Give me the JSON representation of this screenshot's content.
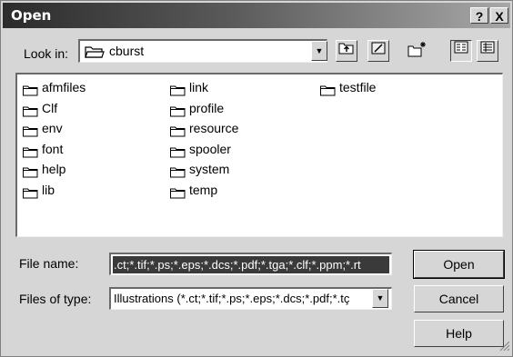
{
  "window": {
    "title": "Open",
    "help_glyph": "?",
    "close_glyph": "X"
  },
  "lookin": {
    "label": "Look in:",
    "value": "cburst"
  },
  "toolbar": {
    "icons": [
      "up-one-level-icon",
      "desktop-icon",
      "create-new-folder-icon",
      "list-view-icon",
      "details-view-icon"
    ]
  },
  "files": {
    "items": [
      {
        "name": "afmfiles"
      },
      {
        "name": "Clf"
      },
      {
        "name": "env"
      },
      {
        "name": "font"
      },
      {
        "name": "help"
      },
      {
        "name": "lib"
      },
      {
        "name": "link"
      },
      {
        "name": "profile"
      },
      {
        "name": "resource"
      },
      {
        "name": "spooler"
      },
      {
        "name": "system"
      },
      {
        "name": "temp"
      },
      {
        "name": "testfile"
      }
    ]
  },
  "filename": {
    "label": "File name:",
    "value": ".ct;*.tif;*.ps;*.eps;*.dcs;*.pdf;*.tga;*.clf;*.ppm;*.rt"
  },
  "filetype": {
    "label": "Files of type:",
    "value": "Illustrations (*.ct;*.tif;*.ps;*.eps;*.dcs;*.pdf;*.tç"
  },
  "buttons": {
    "open": "Open",
    "cancel": "Cancel",
    "help": "Help"
  },
  "colors": {
    "dialog_bg": "#d6d6d6",
    "selection": "#3a3a3a",
    "title_gradient_start": "#2b2b2b"
  }
}
